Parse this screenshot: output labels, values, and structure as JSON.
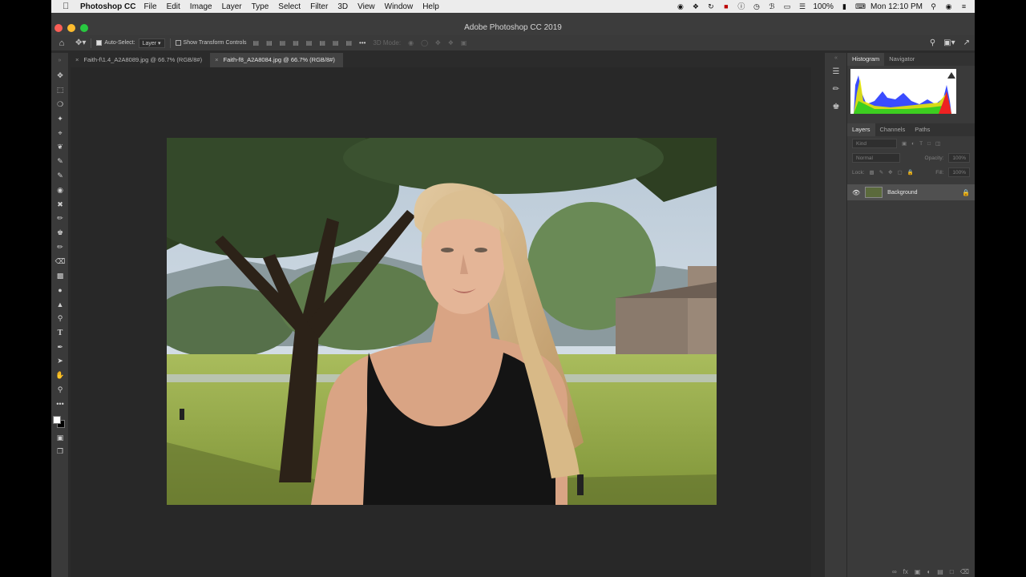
{
  "menubar": {
    "app": "Photoshop CC",
    "items": [
      "File",
      "Edit",
      "Image",
      "Layer",
      "Type",
      "Select",
      "Filter",
      "3D",
      "View",
      "Window",
      "Help"
    ],
    "battery": "100%",
    "clock": "Mon 12:10 PM"
  },
  "window": {
    "title": "Adobe Photoshop CC 2019"
  },
  "options": {
    "auto_select_label": "Auto-Select:",
    "auto_select_value": "Layer",
    "show_transform_label": "Show Transform Controls",
    "mode_3d": "3D Mode:"
  },
  "tabs": [
    {
      "label": "Faith-f\\1.4_A2A8089.jpg @ 66.7% (RGB/8#)",
      "active": false
    },
    {
      "label": "Faith-f8_A2A8084.jpg @ 66.7% (RGB/8#)",
      "active": true
    }
  ],
  "panels": {
    "top_tabs": [
      "Histogram",
      "Navigator"
    ],
    "layer_tabs": [
      "Layers",
      "Channels",
      "Paths"
    ],
    "kind_placeholder": "Kind",
    "blend_mode": "Normal",
    "opacity_label": "Opacity:",
    "opacity_value": "100%",
    "lock_label": "Lock:",
    "fill_label": "Fill:",
    "fill_value": "100%",
    "layer_name": "Background"
  }
}
